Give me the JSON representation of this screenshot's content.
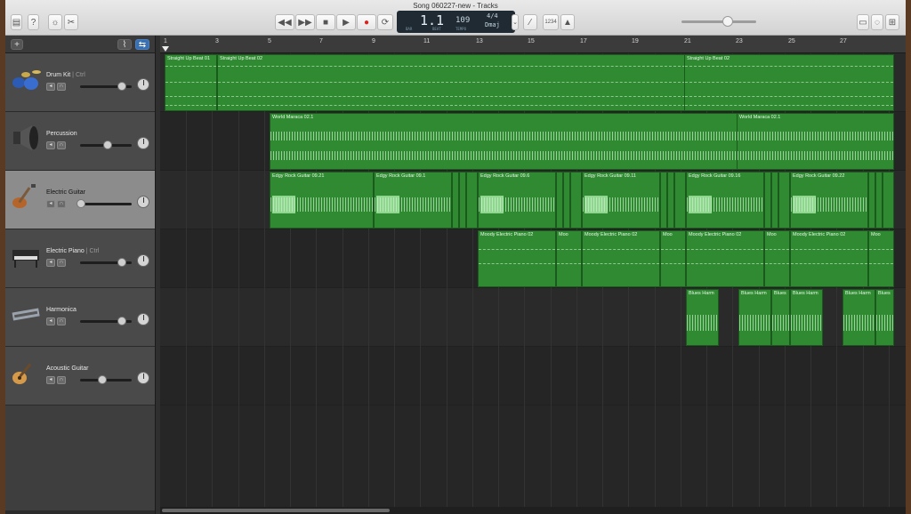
{
  "window": {
    "title": "Song 060227-new - Tracks"
  },
  "transport": {
    "position": "1.1",
    "bar_label": "BAR",
    "beat_label": "BEAT",
    "tempo": "109",
    "tempo_label": "TEMPO",
    "signature": "4/4",
    "key": "Dmaj",
    "count_in": "1234"
  },
  "ruler": {
    "bars": [
      "1",
      "3",
      "5",
      "7",
      "9",
      "11",
      "13",
      "15",
      "17",
      "19",
      "21",
      "23",
      "25",
      "27"
    ]
  },
  "tracks": [
    {
      "name": "Drum Kit",
      "ctl": " | Ctrl",
      "icon": "drum-kit-icon"
    },
    {
      "name": "Percussion",
      "ctl": "",
      "icon": "speaker-icon"
    },
    {
      "name": "Electric Guitar",
      "ctl": "",
      "icon": "electric-guitar-icon"
    },
    {
      "name": "Electric Piano",
      "ctl": " | Ctrl",
      "icon": "electric-piano-icon"
    },
    {
      "name": "Harmonica",
      "ctl": "",
      "icon": "harmonica-icon"
    },
    {
      "name": "Acoustic Guitar",
      "ctl": "",
      "icon": "acoustic-guitar-icon"
    }
  ],
  "regions": {
    "drum": [
      "Straight Up Beat 01",
      "Straight Up Beat 02",
      "Straight Up Beat 02"
    ],
    "perc": [
      "World Maraca 02.1",
      "World Maraca 02.1"
    ],
    "guitar": [
      "Edgy Rock Guitar 09.21",
      "Edgy Rock Guitar 09.1",
      "Edgy Rock Guitar 09.6",
      "Edgy Rock Guitar 09.11",
      "Edgy Rock Guitar 09.16",
      "Edgy Rock Guitar 09.22"
    ],
    "piano": [
      "Moody Electric Piano 02",
      "Moo",
      "Moody Electric Piano 02",
      "Moo",
      "Moody Electric Piano 02",
      "Moo",
      "Moody Electric Piano 02",
      "Moo"
    ],
    "harm": [
      "Blues Harm",
      "Blues Harm",
      "Blues",
      "Blues Harm",
      "Blues Harm",
      "Blues"
    ]
  }
}
